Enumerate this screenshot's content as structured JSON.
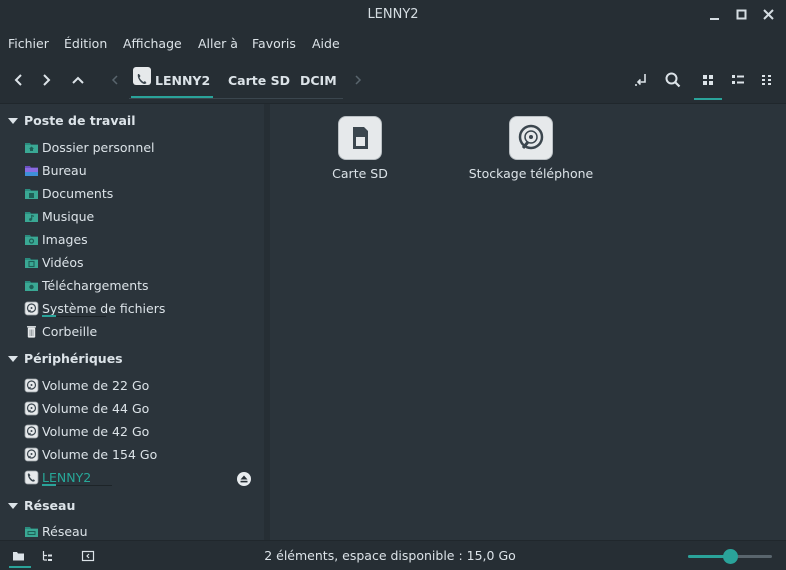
{
  "window": {
    "title": "LENNY2"
  },
  "menu": [
    "Fichier",
    "Édition",
    "Affichage",
    "Aller à",
    "Favoris",
    "Aide"
  ],
  "breadcrumb": [
    "LENNY2",
    "Carte SD",
    "DCIM"
  ],
  "sidebar": {
    "sections": [
      {
        "title": "Poste de travail",
        "items": [
          {
            "label": "Dossier personnel",
            "icon": "home-folder-icon"
          },
          {
            "label": "Bureau",
            "icon": "desktop-folder-icon"
          },
          {
            "label": "Documents",
            "icon": "documents-folder-icon"
          },
          {
            "label": "Musique",
            "icon": "music-folder-icon"
          },
          {
            "label": "Images",
            "icon": "pictures-folder-icon"
          },
          {
            "label": "Vidéos",
            "icon": "videos-folder-icon"
          },
          {
            "label": "Téléchargements",
            "icon": "downloads-folder-icon"
          },
          {
            "label": "Système de fichiers",
            "icon": "drive-icon"
          },
          {
            "label": "Corbeille",
            "icon": "trash-icon"
          }
        ]
      },
      {
        "title": "Périphériques",
        "items": [
          {
            "label": "Volume de 22 Go",
            "icon": "drive-icon"
          },
          {
            "label": "Volume de 44 Go",
            "icon": "drive-icon"
          },
          {
            "label": "Volume de 42 Go",
            "icon": "drive-icon"
          },
          {
            "label": "Volume de 154 Go",
            "icon": "drive-icon"
          },
          {
            "label": "LENNY2",
            "icon": "phone-icon"
          }
        ]
      },
      {
        "title": "Réseau",
        "items": [
          {
            "label": "Réseau",
            "icon": "network-folder-icon"
          }
        ]
      }
    ]
  },
  "files": [
    {
      "name": "Carte SD",
      "icon": "sd-card-icon"
    },
    {
      "name": "Stockage téléphone",
      "icon": "hard-disk-icon"
    }
  ],
  "status": {
    "text": "2 éléments, espace disponible : 15,0 Go",
    "zoom_fraction": 0.5
  },
  "colors": {
    "accent": "#2aa39a",
    "background": "#2b343b",
    "chrome": "#262e34",
    "text": "#dce3e8"
  }
}
